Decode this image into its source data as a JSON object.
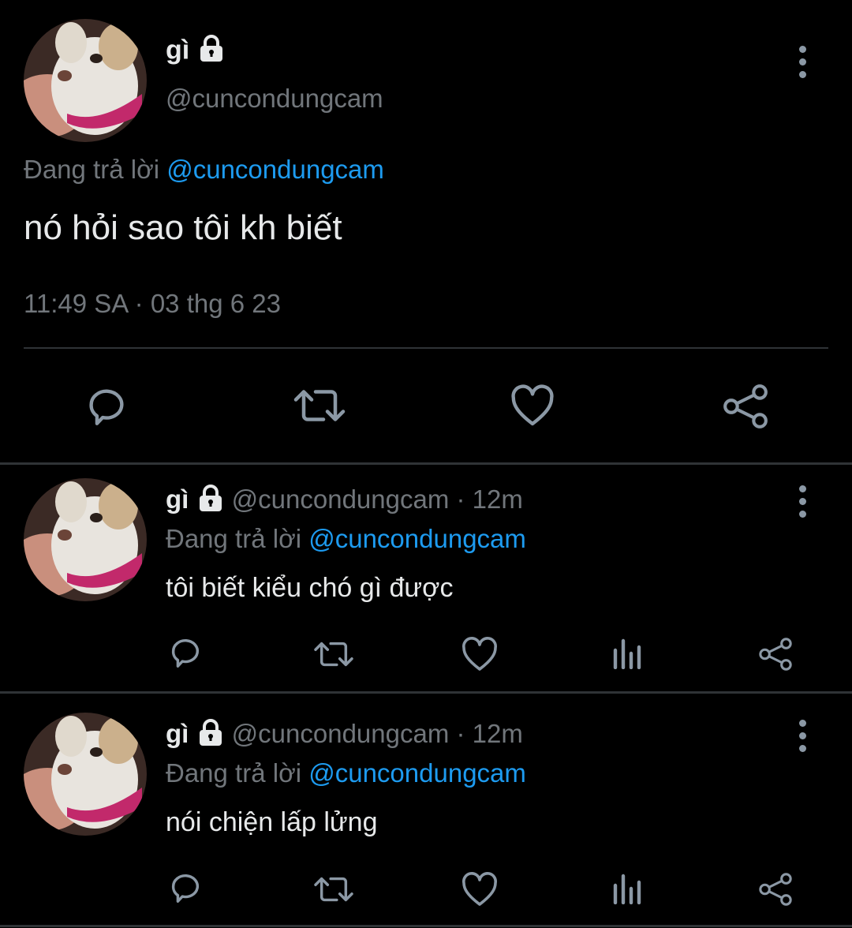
{
  "main_tweet": {
    "display_name": "gì",
    "handle": "@cuncondungcam",
    "replying_prefix": "Đang trả lời",
    "replying_to": "@cuncondungcam",
    "text": "nó hỏi sao tôi kh biết",
    "timestamp": "11:49 SA · 03 thg 6 23"
  },
  "replies": [
    {
      "display_name": "gì",
      "handle": "@cuncondungcam",
      "time": "· 12m",
      "replying_prefix": "Đang trả lời",
      "replying_to": "@cuncondungcam",
      "text": "tôi biết kiểu chó gì được"
    },
    {
      "display_name": "gì",
      "handle": "@cuncondungcam",
      "time": "· 12m",
      "replying_prefix": "Đang trả lời",
      "replying_to": "@cuncondungcam",
      "text": "nói chiện lấp lửng"
    }
  ],
  "icons": {
    "reply": "reply-icon",
    "retweet": "retweet-icon",
    "like": "heart-icon",
    "views": "views-icon",
    "share": "share-icon",
    "more": "more-icon",
    "lock": "lock-icon"
  },
  "colors": {
    "background": "#000000",
    "text": "#e7e9ea",
    "muted": "#71767b",
    "accent": "#1d9bf0",
    "divider": "#2f3336"
  }
}
